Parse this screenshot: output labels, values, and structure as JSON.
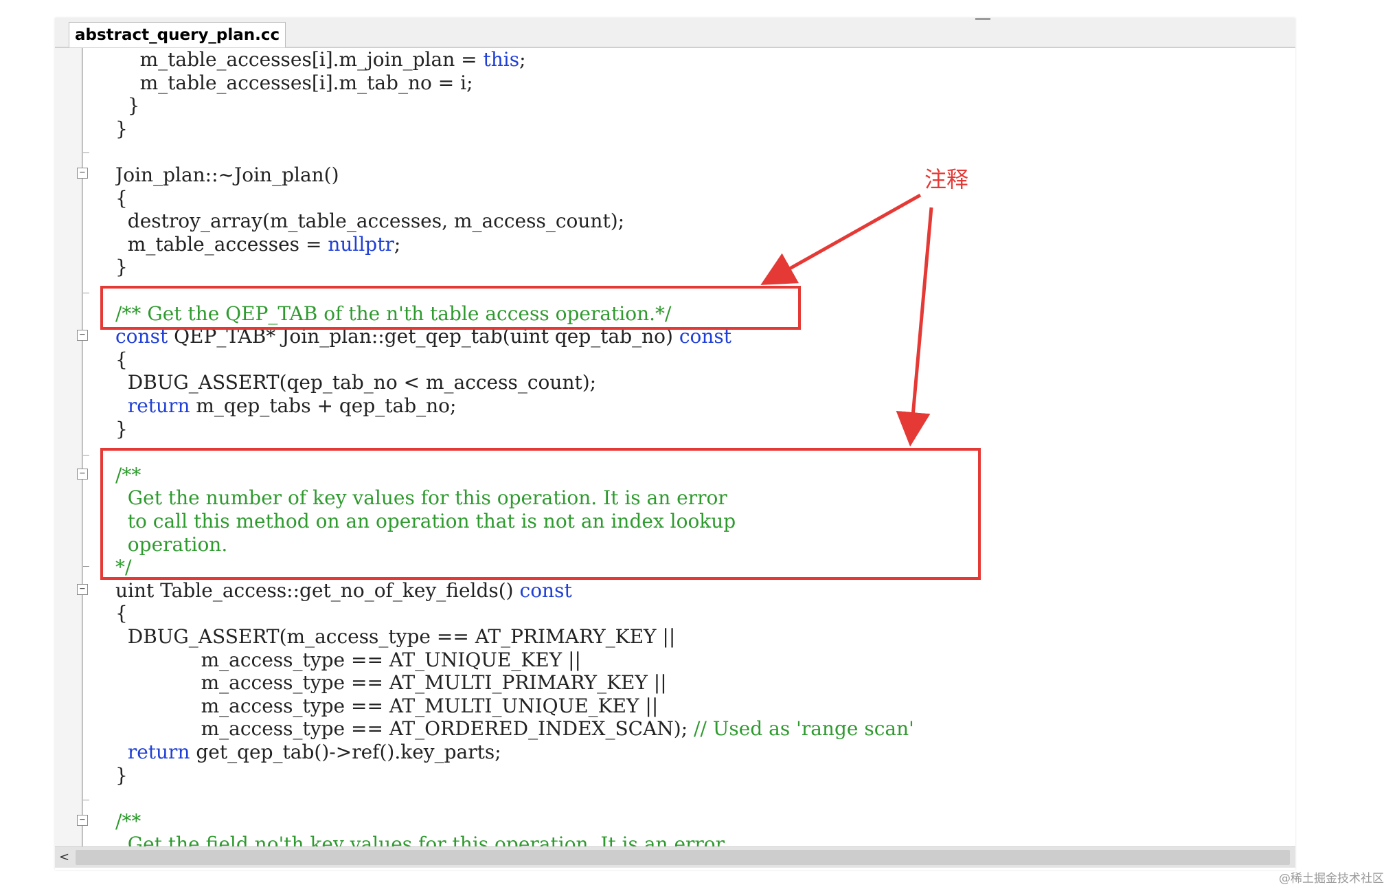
{
  "editor": {
    "tab_title": "abstract_query_plan.cc"
  },
  "code_lines": [
    [
      {
        "t": "    m_table_accesses[i].m_join_plan = ",
        "c": "pl"
      },
      {
        "t": "this",
        "c": "kw"
      },
      {
        "t": ";",
        "c": "pl"
      }
    ],
    [
      {
        "t": "    m_table_accesses[i].m_tab_no = i;",
        "c": "pl"
      }
    ],
    [
      {
        "t": "  }",
        "c": "pl"
      }
    ],
    [
      {
        "t": "}",
        "c": "pl"
      }
    ],
    [
      {
        "t": "",
        "c": "pl"
      }
    ],
    [
      {
        "t": "Join_plan::~Join_plan()",
        "c": "pl"
      }
    ],
    [
      {
        "t": "{",
        "c": "pl"
      }
    ],
    [
      {
        "t": "  destroy_array(m_table_accesses, m_access_count);",
        "c": "pl"
      }
    ],
    [
      {
        "t": "  m_table_accesses = ",
        "c": "pl"
      },
      {
        "t": "nullptr",
        "c": "kw"
      },
      {
        "t": ";",
        "c": "pl"
      }
    ],
    [
      {
        "t": "}",
        "c": "pl"
      }
    ],
    [
      {
        "t": "",
        "c": "pl"
      }
    ],
    [
      {
        "t": "/** Get the QEP_TAB of the n'th table access operation.*/",
        "c": "cm"
      }
    ],
    [
      {
        "t": "const",
        "c": "kw"
      },
      {
        "t": " QEP_TAB* Join_plan::get_qep_tab(uint qep_tab_no) ",
        "c": "pl"
      },
      {
        "t": "const",
        "c": "kw"
      }
    ],
    [
      {
        "t": "{",
        "c": "pl"
      }
    ],
    [
      {
        "t": "  DBUG_ASSERT(qep_tab_no < m_access_count);",
        "c": "pl"
      }
    ],
    [
      {
        "t": "  ",
        "c": "pl"
      },
      {
        "t": "return",
        "c": "kw"
      },
      {
        "t": " m_qep_tabs + qep_tab_no;",
        "c": "pl"
      }
    ],
    [
      {
        "t": "}",
        "c": "pl"
      }
    ],
    [
      {
        "t": "",
        "c": "pl"
      }
    ],
    [
      {
        "t": "/**",
        "c": "cm"
      }
    ],
    [
      {
        "t": "  Get the number of key values for this operation. It is an error",
        "c": "cm"
      }
    ],
    [
      {
        "t": "  to call this method on an operation that is not an index lookup",
        "c": "cm"
      }
    ],
    [
      {
        "t": "  operation.",
        "c": "cm"
      }
    ],
    [
      {
        "t": "*/",
        "c": "cm"
      }
    ],
    [
      {
        "t": "uint Table_access::get_no_of_key_fields() ",
        "c": "pl"
      },
      {
        "t": "const",
        "c": "kw"
      }
    ],
    [
      {
        "t": "{",
        "c": "pl"
      }
    ],
    [
      {
        "t": "  DBUG_ASSERT(m_access_type == AT_PRIMARY_KEY ||",
        "c": "pl"
      }
    ],
    [
      {
        "t": "              m_access_type == AT_UNIQUE_KEY ||",
        "c": "pl"
      }
    ],
    [
      {
        "t": "              m_access_type == AT_MULTI_PRIMARY_KEY ||",
        "c": "pl"
      }
    ],
    [
      {
        "t": "              m_access_type == AT_MULTI_UNIQUE_KEY ||",
        "c": "pl"
      }
    ],
    [
      {
        "t": "              m_access_type == AT_ORDERED_INDEX_SCAN); ",
        "c": "pl"
      },
      {
        "t": "// Used as 'range scan'",
        "c": "cm"
      }
    ],
    [
      {
        "t": "  ",
        "c": "pl"
      },
      {
        "t": "return",
        "c": "kw"
      },
      {
        "t": " get_qep_tab()->ref().key_parts;",
        "c": "pl"
      }
    ],
    [
      {
        "t": "}",
        "c": "pl"
      }
    ],
    [
      {
        "t": "",
        "c": "pl"
      }
    ],
    [
      {
        "t": "/**",
        "c": "cm"
      }
    ],
    [
      {
        "t": "  Get the field no'th key values for this operation. It is an error",
        "c": "cm"
      }
    ]
  ],
  "annotation": {
    "label": "注释",
    "color": "#e53935"
  },
  "scrollbar": {
    "left_arrow": "<"
  },
  "watermark": "@稀土掘金技术社区",
  "colors": {
    "keyword": "#1f3fd6",
    "comment": "#2e9a2e",
    "plain": "#222222"
  }
}
